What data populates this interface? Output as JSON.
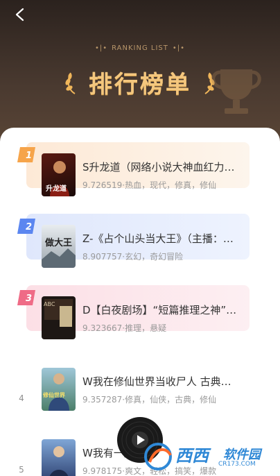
{
  "header": {
    "ranking_en": "RANKING LIST",
    "title": "排行榜单"
  },
  "books": [
    {
      "rank": "1",
      "title": "S升龙道（网络小说大神血红力…",
      "meta": "9.726519·热血，现代，修真，修仙",
      "cover_text": "升龙道"
    },
    {
      "rank": "2",
      "title": "Z-《占个山头当大王》（主播：…",
      "meta": "8.907757·玄幻，奇幻冒险",
      "cover_text": "做大王"
    },
    {
      "rank": "3",
      "title": "D【白夜剧场】“短篇推理之神”…",
      "meta": "9.323667·推理，悬疑",
      "cover_text": "ABC"
    },
    {
      "rank": "4",
      "title": "W我在修仙世界当收尸人 古典…",
      "meta": "9.357287·修真，仙侠，古典，修仙",
      "cover_text": "修仙世界"
    },
    {
      "rank": "5",
      "title": "W我有一座…",
      "meta": "9.978175·爽文，轻松，搞笑，爆款",
      "cover_text": ""
    }
  ],
  "watermark": {
    "brand": "西西",
    "sub": "软件园",
    "url": "CR173.COM"
  },
  "colors": {
    "header_dark": "#2b221e",
    "title_gold": "#f4c77e",
    "rank1_bg": "#fdf1e4",
    "rank2_bg": "#e9effd",
    "rank3_bg": "#fde9ee"
  }
}
